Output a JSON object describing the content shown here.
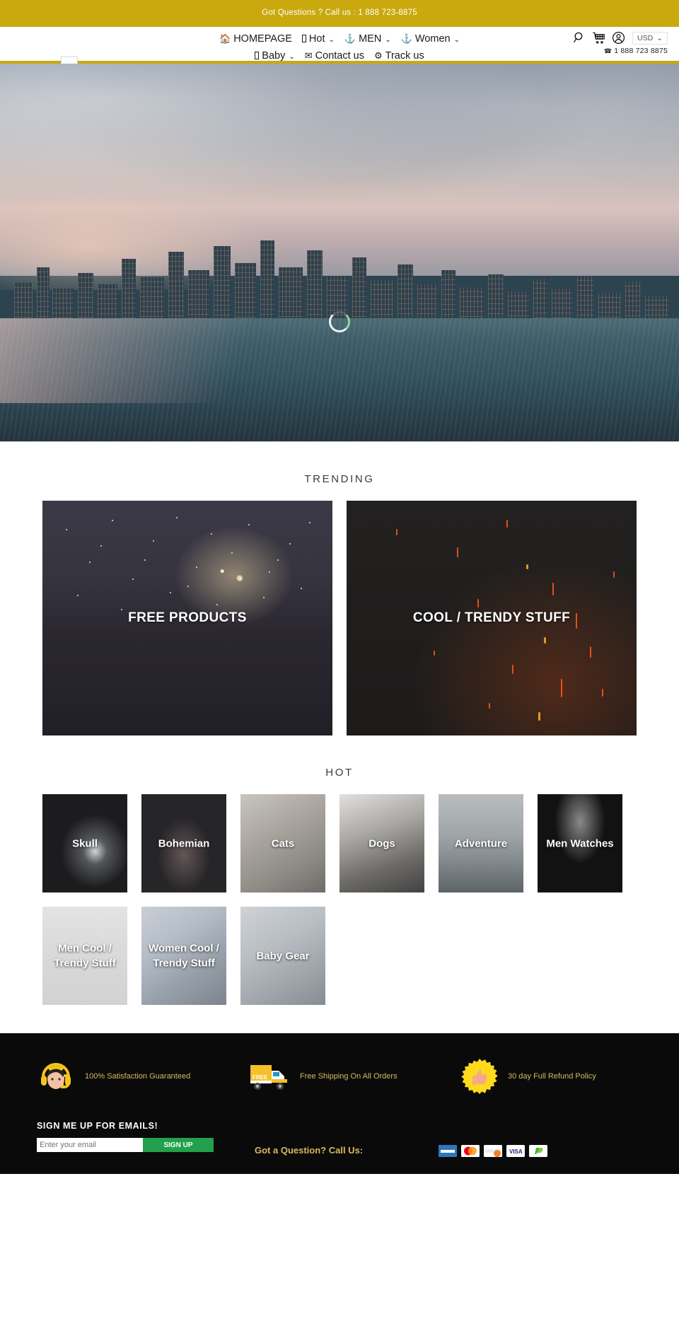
{
  "announcement": {
    "text": "Got Questions ? Call us : 1 888 723-8875"
  },
  "header": {
    "logo_alt": "store-logo",
    "nav": [
      {
        "label": "HOMEPAGE",
        "icon": "home-icon",
        "has_caret": false
      },
      {
        "label": "Hot",
        "icon": "missing-glyph-icon",
        "has_caret": true
      },
      {
        "label": "MEN",
        "icon": "anchor-icon",
        "has_caret": true
      },
      {
        "label": "Women",
        "icon": "anchor-icon",
        "has_caret": true
      },
      {
        "label": "Baby",
        "icon": "missing-glyph-icon",
        "has_caret": true
      },
      {
        "label": "Contact us",
        "icon": "envelope-icon",
        "has_caret": false
      },
      {
        "label": "Track us",
        "icon": "gears-icon",
        "has_caret": false
      }
    ],
    "icons": [
      "search-icon",
      "cart-icon",
      "account-icon"
    ],
    "currency": "USD",
    "phone": "1 888 723 8875"
  },
  "hero": {
    "alt": "city-skyline-waterfront-banner",
    "loading": "carousel-spinner"
  },
  "trending": {
    "title": "TRENDING",
    "cards": [
      {
        "label": "FREE PRODUCTS",
        "art": "sparkler"
      },
      {
        "label": "COOL / TRENDY STUFF",
        "art": "embers"
      }
    ]
  },
  "hot": {
    "title": "HOT",
    "tiles": [
      {
        "label": "Skull",
        "art": "skull"
      },
      {
        "label": "Bohemian",
        "art": "boho"
      },
      {
        "label": "Cats",
        "art": "cats"
      },
      {
        "label": "Dogs",
        "art": "dogs"
      },
      {
        "label": "Adventure",
        "art": "adventure"
      },
      {
        "label": "Men Watches",
        "art": "watch"
      },
      {
        "label": "Men Cool / Trendy Stuff",
        "art": "mencool"
      },
      {
        "label": "Women Cool / Trendy Stuff",
        "art": "womencool"
      },
      {
        "label": "Baby Gear",
        "art": "baby"
      }
    ]
  },
  "footer": {
    "trust": [
      {
        "text": "100% Satisfaction Guaranteed",
        "icon": "support-agent-icon"
      },
      {
        "text": "Free Shipping On All Orders",
        "icon": "free-shipping-truck-icon"
      },
      {
        "text": "30 day Full Refund Policy",
        "icon": "thumbs-up-badge-icon"
      }
    ],
    "newsletter": {
      "title": "SIGN ME UP FOR EMAILS!",
      "placeholder": "Enter your email",
      "value": "",
      "button": "SIGN UP"
    },
    "question_label": "Got a Question? Call Us:",
    "payments": [
      "amex",
      "mastercard",
      "discover",
      "visa",
      "paypal"
    ]
  },
  "colors": {
    "brand_gold": "#c9a90d",
    "footer_gold": "#d7ba60",
    "newsletter_green": "#22a04b",
    "footer_bg": "#0a0a0a"
  }
}
